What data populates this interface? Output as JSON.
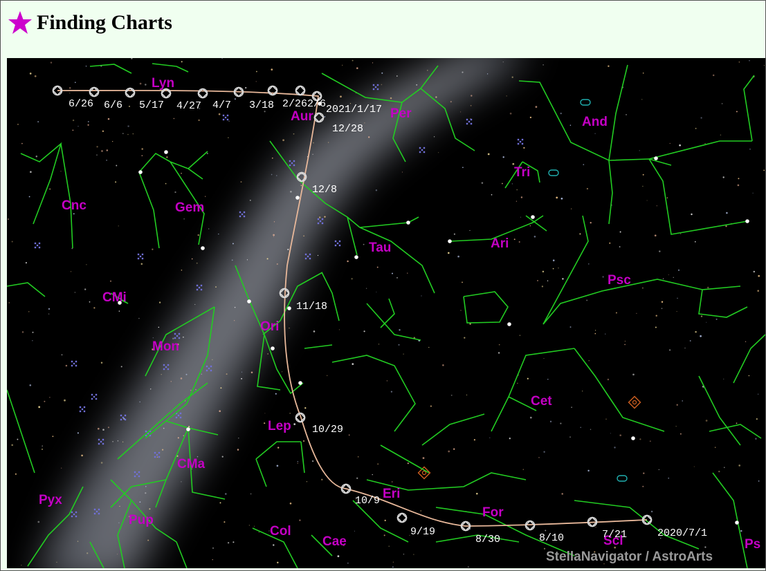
{
  "header": {
    "title": "Finding Charts",
    "icon": "star-icon",
    "icon_color": "#cc00cc"
  },
  "chart": {
    "credit": "StellaNavigator / AstroArts",
    "colors": {
      "background": "#000000",
      "constellation_lines": "#22cc22",
      "constellation_labels": "#c400c4",
      "path": "#e8b89a",
      "date_labels": "#ffffff"
    },
    "constellations": [
      "Lyn",
      "Aur",
      "Per",
      "And",
      "Tri",
      "Cnc",
      "Gem",
      "Tau",
      "Ari",
      "CMi",
      "Psc",
      "Ori",
      "Mon",
      "Cet",
      "Lep",
      "CMa",
      "Pyx",
      "Pup",
      "Eri",
      "For",
      "Col",
      "Cae",
      "Scl",
      "Ps"
    ],
    "path_dates": [
      "6/26",
      "6/6",
      "5/17",
      "4/27",
      "4/7",
      "3/18",
      "2/26",
      "2/6",
      "2021/1/17",
      "12/28",
      "12/8",
      "11/18",
      "10/29",
      "10/9",
      "9/19",
      "8/30",
      "8/10",
      "7/21",
      "2020/7/1"
    ]
  }
}
